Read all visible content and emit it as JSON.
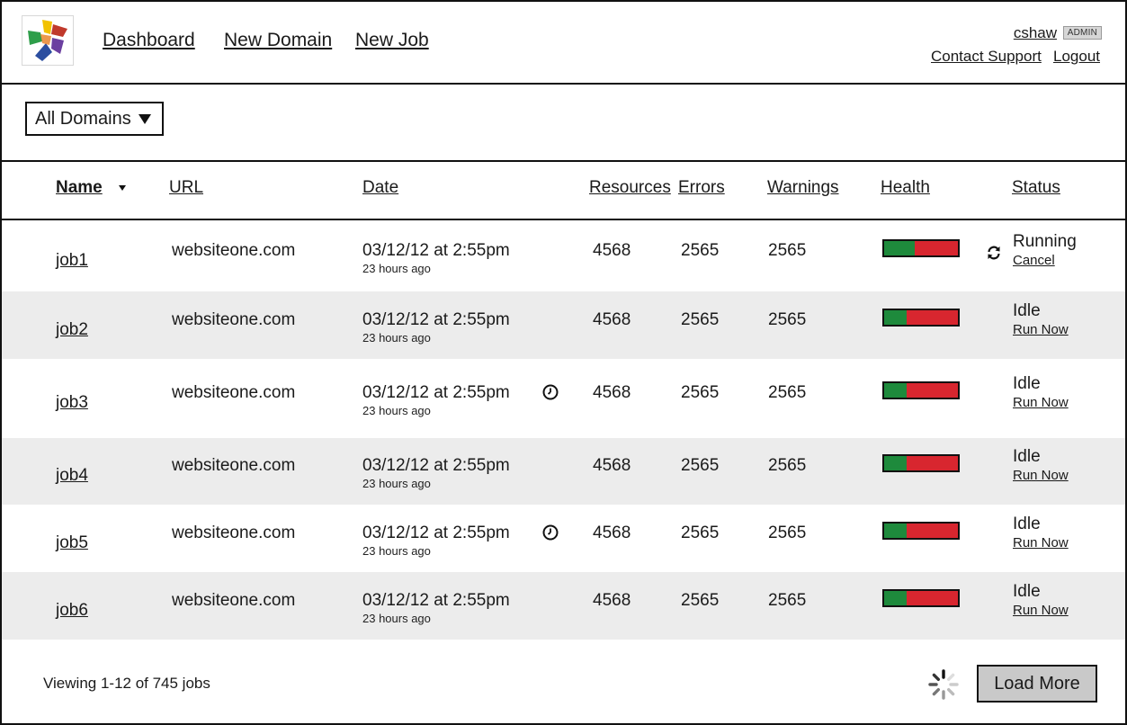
{
  "header": {
    "nav": [
      "Dashboard",
      "New Domain",
      "New Job"
    ],
    "username": "cshaw",
    "role_badge": "ADMIN",
    "contact_support": "Contact Support",
    "logout": "Logout"
  },
  "filter": {
    "domain_select": "All Domains"
  },
  "table": {
    "columns": {
      "name": "Name",
      "url": "URL",
      "date": "Date",
      "resources": "Resources",
      "errors": "Errors",
      "warnings": "Warnings",
      "health": "Health",
      "status": "Status"
    },
    "rows": [
      {
        "name": "job1",
        "url": "websiteone.com",
        "date": "03/12/12 at 2:55pm",
        "ago": "23 hours ago",
        "resources": "4568",
        "errors": "2565",
        "warnings": "2565",
        "health_fraction": 0.42,
        "status": "Running",
        "action": "Cancel",
        "scheduled": false,
        "running": true
      },
      {
        "name": "job2",
        "url": "websiteone.com",
        "date": "03/12/12 at 2:55pm",
        "ago": "23 hours ago",
        "resources": "4568",
        "errors": "2565",
        "warnings": "2565",
        "health_fraction": 0.31,
        "status": "Idle",
        "action": "Run Now",
        "scheduled": false,
        "running": false
      },
      {
        "name": "job3",
        "url": "websiteone.com",
        "date": "03/12/12 at 2:55pm",
        "ago": "23 hours ago",
        "resources": "4568",
        "errors": "2565",
        "warnings": "2565",
        "health_fraction": 0.31,
        "status": "Idle",
        "action": "Run Now",
        "scheduled": true,
        "running": false
      },
      {
        "name": "job4",
        "url": "websiteone.com",
        "date": "03/12/12 at 2:55pm",
        "ago": "23 hours ago",
        "resources": "4568",
        "errors": "2565",
        "warnings": "2565",
        "health_fraction": 0.31,
        "status": "Idle",
        "action": "Run Now",
        "scheduled": false,
        "running": false
      },
      {
        "name": "job5",
        "url": "websiteone.com",
        "date": "03/12/12 at 2:55pm",
        "ago": "23 hours ago",
        "resources": "4568",
        "errors": "2565",
        "warnings": "2565",
        "health_fraction": 0.31,
        "status": "Idle",
        "action": "Run Now",
        "scheduled": true,
        "running": false
      },
      {
        "name": "job6",
        "url": "websiteone.com",
        "date": "03/12/12 at 2:55pm",
        "ago": "23 hours ago",
        "resources": "4568",
        "errors": "2565",
        "warnings": "2565",
        "health_fraction": 0.31,
        "status": "Idle",
        "action": "Run Now",
        "scheduled": false,
        "running": false
      }
    ]
  },
  "footer": {
    "viewing": "Viewing 1-12 of 745  jobs",
    "load_more": "Load More"
  },
  "colors": {
    "health_good": "#1e8a3c",
    "health_bad": "#d8262f",
    "row_alt": "#ececec",
    "button_bg": "#c9c9c9"
  },
  "icons": {
    "logo": "multicolor-star-logo",
    "sort": "sort-desc-icon",
    "select_arrow": "dropdown-arrow-icon",
    "scheduled": "clock-icon",
    "running": "refresh-icon",
    "loading": "spinner-icon"
  }
}
